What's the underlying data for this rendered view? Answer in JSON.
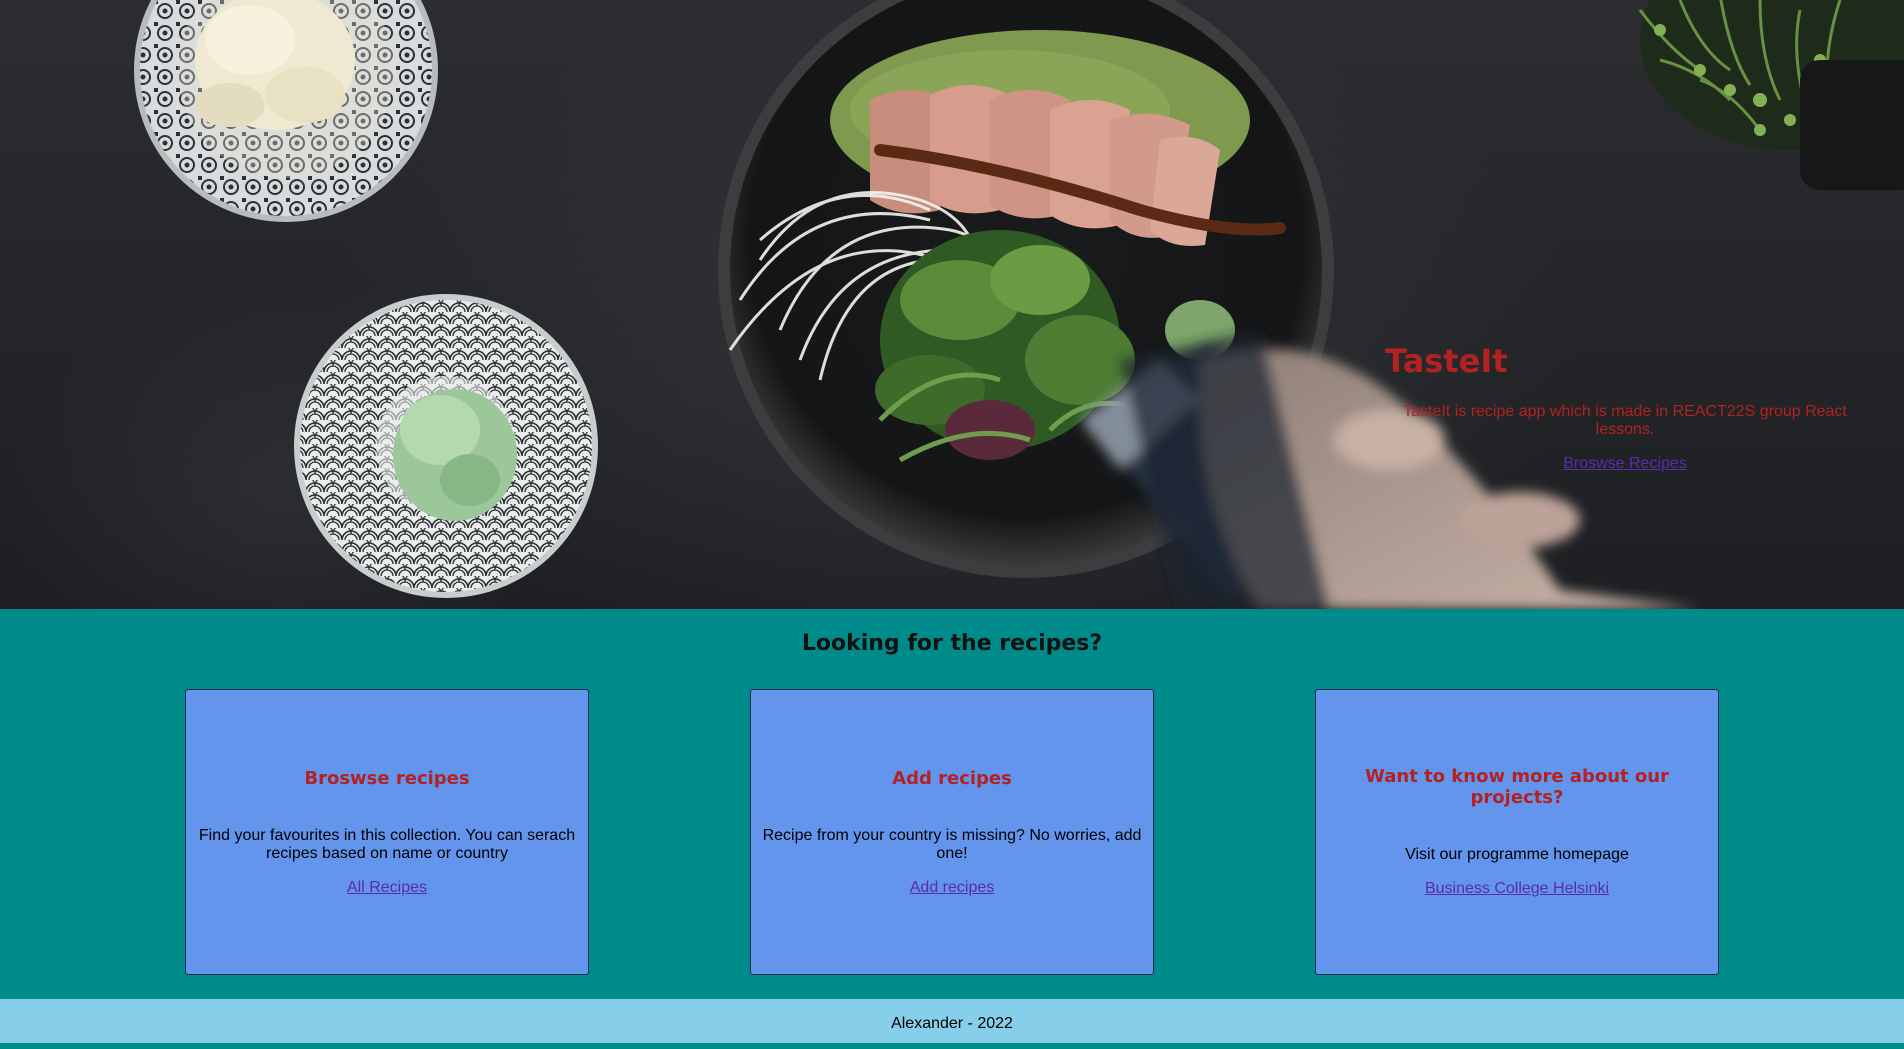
{
  "hero": {
    "title": "TasteIt",
    "description": "TasteIt is recipe app which is made in REACT22S group React lessons.",
    "link_label": "Broswse Recipes"
  },
  "section": {
    "title": "Looking for the recipes?",
    "cards": [
      {
        "title": "Broswse recipes",
        "text": "Find your favourites in this collection. You can serach recipes based on name or country",
        "link_label": "All Recipes"
      },
      {
        "title": "Add recipes",
        "text": "Recipe from your country is missing? No worries, add one!",
        "link_label": "Add recipes"
      },
      {
        "title": "Want to know more about our projects?",
        "text": "Visit our programme homepage",
        "link_label": "Business College Helsinki"
      }
    ]
  },
  "footer": {
    "text": "Alexander - 2022"
  },
  "colors": {
    "teal_section": "#008b8b",
    "card_background": "#6495ed",
    "heading_red": "#b22222",
    "link_purple": "#5b2ca8",
    "footer_background": "#87ceeb"
  }
}
